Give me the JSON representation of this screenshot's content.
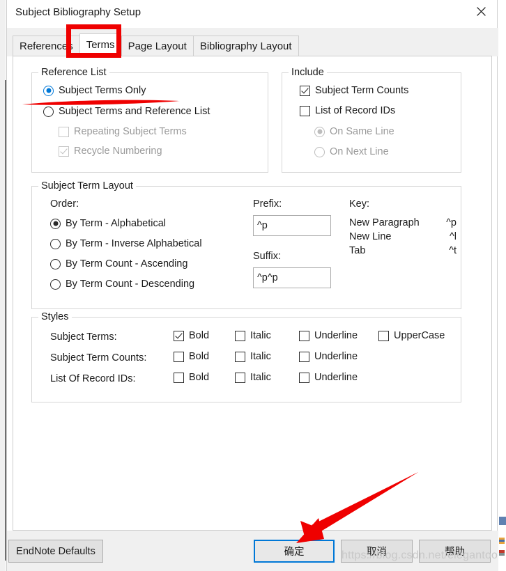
{
  "window": {
    "title": "Subject Bibliography Setup",
    "close_icon": "close-icon"
  },
  "tabs": [
    {
      "label": "References",
      "active": false
    },
    {
      "label": "Terms",
      "active": true
    },
    {
      "label": "Page Layout",
      "active": false
    },
    {
      "label": "Bibliography Layout",
      "active": false
    }
  ],
  "reference_list": {
    "legend": "Reference List",
    "options": [
      {
        "label": "Subject Terms Only",
        "selected": true
      },
      {
        "label": "Subject Terms and Reference List",
        "selected": false
      }
    ],
    "sub_options": [
      {
        "label": "Repeating Subject Terms",
        "checked": false,
        "disabled": true
      },
      {
        "label": "Recycle Numbering",
        "checked": true,
        "disabled": true
      }
    ]
  },
  "include": {
    "legend": "Include",
    "checkboxes": [
      {
        "label": "Subject Term Counts",
        "checked": true,
        "disabled": false
      },
      {
        "label": "List of Record IDs",
        "checked": false,
        "disabled": false
      }
    ],
    "radios": [
      {
        "label": "On Same Line",
        "selected": true,
        "disabled": true
      },
      {
        "label": "On Next Line",
        "selected": false,
        "disabled": true
      }
    ]
  },
  "subject_term_layout": {
    "legend": "Subject Term Layout",
    "order_label": "Order:",
    "order_options": [
      {
        "label": "By Term - Alphabetical",
        "selected": true
      },
      {
        "label": "By Term - Inverse Alphabetical",
        "selected": false
      },
      {
        "label": "By Term Count - Ascending",
        "selected": false
      },
      {
        "label": "By Term Count - Descending",
        "selected": false
      }
    ],
    "prefix_label": "Prefix:",
    "prefix_value": "^p",
    "suffix_label": "Suffix:",
    "suffix_value": "^p^p",
    "key_label": "Key:",
    "key_rows": [
      {
        "name": "New Paragraph",
        "code": "^p"
      },
      {
        "name": "New Line",
        "code": "^l"
      },
      {
        "name": "Tab",
        "code": "^t"
      }
    ]
  },
  "styles": {
    "legend": "Styles",
    "rows": [
      {
        "label": "Subject Terms:",
        "options": [
          {
            "label": "Bold",
            "checked": true
          },
          {
            "label": "Italic",
            "checked": false
          },
          {
            "label": "Underline",
            "checked": false
          },
          {
            "label": "UpperCase",
            "checked": false
          }
        ]
      },
      {
        "label": "Subject Term Counts:",
        "options": [
          {
            "label": "Bold",
            "checked": false
          },
          {
            "label": "Italic",
            "checked": false
          },
          {
            "label": "Underline",
            "checked": false
          }
        ]
      },
      {
        "label": "List Of Record IDs:",
        "options": [
          {
            "label": "Bold",
            "checked": false
          },
          {
            "label": "Italic",
            "checked": false
          },
          {
            "label": "Underline",
            "checked": false
          }
        ]
      }
    ]
  },
  "buttons": {
    "endnote_defaults": "EndNote Defaults",
    "ok": "确定",
    "cancel": "取消",
    "help": "帮助"
  },
  "annotations": {
    "highlight_color": "#ef0000",
    "tab_box_target": "Terms",
    "underline_target": "Subject Terms Only",
    "arrow_target": "确定"
  },
  "watermark": "https://blog.csdn.net/elegantoo",
  "colors": {
    "accent": "#0078d7",
    "dialog_bg": "#ffffff",
    "chrome_bg": "#f0f0f0",
    "button_bg": "#e1e1e1",
    "annotation_red": "#ef0000"
  }
}
